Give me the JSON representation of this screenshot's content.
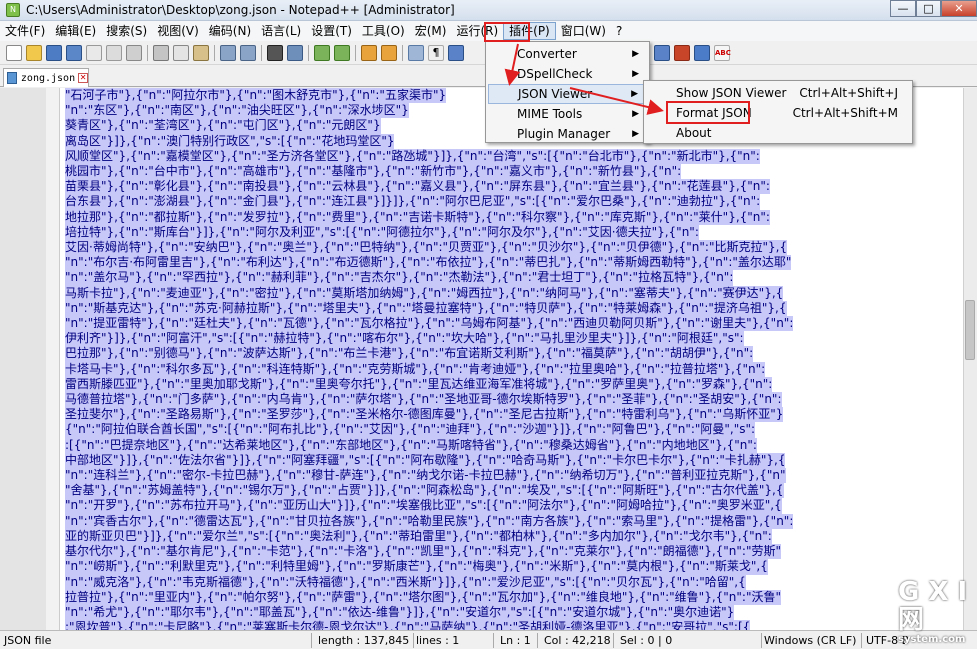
{
  "window": {
    "title": "C:\\Users\\Administrator\\Desktop\\zong.json - Notepad++ [Administrator]",
    "controls": {
      "minimize": "—",
      "maximize": "□",
      "close": "✕"
    }
  },
  "menubar": {
    "items": [
      "文件(F)",
      "编辑(E)",
      "搜索(S)",
      "视图(V)",
      "编码(N)",
      "语言(L)",
      "设置(T)",
      "工具(O)",
      "宏(M)",
      "运行(R)",
      "插件(P)",
      "窗口(W)",
      "?"
    ]
  },
  "tab": {
    "label": "zong.json",
    "close": "✕"
  },
  "plugin_menu": {
    "items": [
      {
        "label": "Converter",
        "arrow": "▶"
      },
      {
        "label": "DSpellCheck",
        "arrow": "▶"
      },
      {
        "label": "JSON Viewer",
        "arrow": "▶"
      },
      {
        "label": "MIME Tools",
        "arrow": "▶"
      },
      {
        "label": "Plugin Manager",
        "arrow": "▶"
      }
    ]
  },
  "json_viewer_submenu": {
    "items": [
      {
        "label": "Show JSON Viewer",
        "shortcut": "Ctrl+Alt+Shift+J"
      },
      {
        "label": "Format JSON",
        "shortcut": "Ctrl+Alt+Shift+M"
      },
      {
        "label": "About",
        "shortcut": ""
      }
    ]
  },
  "editor": {
    "lines": [
      "\"石河子市\"},{\"n\":\"阿拉尔市\"},{\"n\":\"图木舒克市\"},{\"n\":\"五家渠市\"}",
      "\"n\":\"东区\"},{\"n\":\"南区\"},{\"n\":\"油尖旺区\"},{\"n\":\"深水埗区\"}",
      "葵青区\"},{\"n\":\"荃湾区\"},{\"n\":\"屯门区\"},{\"n\":\"元朗区\"}",
      "离岛区\"}]},{\"n\":\"澳门特别行政区\",\"s\":[{\"n\":\"花地玛堂区\"}",
      "风顺堂区\"},{\"n\":\"嘉模堂区\"},{\"n\":\"圣方济各堂区\"},{\"n\":\"路氹城\"}]},{\"n\":\"台湾\",\"s\":[{\"n\":\"台北市\"},{\"n\":\"新北市\"},{\"n\":",
      "桃园市\"},{\"n\":\"台中市\"},{\"n\":\"高雄市\"},{\"n\":\"基隆市\"},{\"n\":\"新竹市\"},{\"n\":\"嘉义市\"},{\"n\":\"新竹县\"},{\"n\":",
      "苗栗县\"},{\"n\":\"彰化县\"},{\"n\":\"南投县\"},{\"n\":\"云林县\"},{\"n\":\"嘉义县\"},{\"n\":\"屏东县\"},{\"n\":\"宜兰县\"},{\"n\":\"花莲县\"},{\"n\":",
      "台东县\"},{\"n\":\"澎湖县\"},{\"n\":\"金门县\"},{\"n\":\"连江县\"}]}]},{\"n\":\"阿尔巴尼亚\",\"s\":[{\"n\":\"爱尔巴桑\"},{\"n\":\"迪勃拉\"},{\"n\":",
      "地拉那\"},{\"n\":\"都拉斯\"},{\"n\":\"发罗拉\"},{\"n\":\"费里\"},{\"n\":\"吉诺卡斯特\"},{\"n\":\"科尔察\"},{\"n\":\"库克斯\"},{\"n\":\"莱什\"},{\"n\":",
      "培拉特\"},{\"n\":\"斯库台\"}]},{\"n\":\"阿尔及利亚\",\"s\":[{\"n\":\"阿德拉尔\"},{\"n\":\"阿尔及尔\"},{\"n\":\"艾因·德夫拉\"},{\"n\":",
      "艾因·蒂姆尚特\"},{\"n\":\"安纳巴\"},{\"n\":\"奥兰\"},{\"n\":\"巴特纳\"},{\"n\":\"贝贾亚\"},{\"n\":\"贝沙尔\"},{\"n\":\"贝伊德\"},{\"n\":\"比斯克拉\"},{",
      "\"n\":\"布尔吉·布阿雷里吉\"},{\"n\":\"布利达\"},{\"n\":\"布迈德斯\"},{\"n\":\"布依拉\"},{\"n\":\"蒂巴扎\"},{\"n\":\"蒂斯姆西勒特\"},{\"n\":\"盖尔达耶\"",
      "\"n\":\"盖尔马\"},{\"n\":\"罕西拉\"},{\"n\":\"赫利菲\"},{\"n\":\"吉杰尔\"},{\"n\":\"杰勒法\"},{\"n\":\"君士坦丁\"},{\"n\":\"拉格瓦特\"},{\"n\":",
      "马斯卡拉\"},{\"n\":\"麦迪亚\"},{\"n\":\"密拉\"},{\"n\":\"莫斯塔加纳姆\"},{\"n\":\"姆西拉\"},{\"n\":\"纳阿马\"},{\"n\":\"塞蒂夫\"},{\"n\":\"赛伊达\"},{",
      "\"n\":\"斯基克达\"},{\"n\":\"苏克·阿赫拉斯\"},{\"n\":\"塔里夫\"},{\"n\":\"塔曼拉塞特\"},{\"n\":\"特贝萨\"},{\"n\":\"特莱姆森\"},{\"n\":\"提济乌祖\"},{",
      "\"n\":\"提亚雷特\"},{\"n\":\"廷杜夫\"},{\"n\":\"瓦德\"},{\"n\":\"瓦尔格拉\"},{\"n\":\"乌姆布阿基\"},{\"n\":\"西迪贝勒阿贝斯\"},{\"n\":\"谢里夫\"},{\"n\":",
      "伊利齐\"}]},{\"n\":\"阿富汗\",\"s\":[{\"n\":\"赫拉特\"},{\"n\":\"喀布尔\"},{\"n\":\"坎大哈\"},{\"n\":\"马扎里沙里夫\"}]},{\"n\":\"阿根廷\",\"s\":",
      "巴拉那\"},{\"n\":\"别德马\"},{\"n\":\"波萨达斯\"},{\"n\":\"布兰卡港\"},{\"n\":\"布宜诺斯艾利斯\"},{\"n\":\"福莫萨\"},{\"n\":\"胡胡伊\"},{\"n\":",
      "卡塔马卡\"},{\"n\":\"科尔多瓦\"},{\"n\":\"科连特斯\"},{\"n\":\"克劳斯城\"},{\"n\":\"肯考迪娅\"},{\"n\":\"拉里奥哈\"},{\"n\":\"拉普拉塔\"},{\"n\":",
      "雷西斯滕匹亚\"},{\"n\":\"里奥加耶戈斯\"},{\"n\":\"里奥夸尔托\"},{\"n\":\"里瓦达维亚海军准将城\"},{\"n\":\"罗萨里奥\"},{\"n\":\"罗森\"},{\"n\":",
      "马德普拉塔\"},{\"n\":\"门多萨\"},{\"n\":\"内乌肯\"},{\"n\":\"萨尔塔\"},{\"n\":\"圣地亚哥-德尔埃斯特罗\"},{\"n\":\"圣菲\"},{\"n\":\"圣胡安\"},{\"n\":",
      "圣拉斐尔\"},{\"n\":\"圣路易斯\"},{\"n\":\"圣罗莎\"},{\"n\":\"圣米格尔-德图库曼\"},{\"n\":\"圣尼古拉斯\"},{\"n\":\"特雷利乌\"},{\"n\":\"乌斯怀亚\"}",
      "{\"n\":\"阿拉伯联合酋长国\",\"s\":[{\"n\":\"阿布扎比\"},{\"n\":\"艾因\"},{\"n\":\"迪拜\"},{\"n\":\"沙迦\"}]},{\"n\":\"阿鲁巴\"},{\"n\":\"阿曼\",\"s\":",
      ":[{\"n\":\"巴提奈地区\"},{\"n\":\"达希莱地区\"},{\"n\":\"东部地区\"},{\"n\":\"马斯喀特省\"},{\"n\":\"穆桑达姆省\"},{\"n\":\"内地地区\"},{\"n\":",
      "中部地区\"}]},{\"n\":\"佐法尔省\"}]},{\"n\":\"阿塞拜疆\",\"s\":[{\"n\":\"阿布歇隆\"},{\"n\":\"哈奇马斯\"},{\"n\":\"卡尔巴卡尔\"},{\"n\":\"卡扎赫\"},{",
      "\"n\":\"连科兰\"},{\"n\":\"密尔-卡拉巴赫\"},{\"n\":\"穆甘-萨连\"},{\"n\":\"纳戈尔诺-卡拉巴赫\"},{\"n\":\"纳希切万\"},{\"n\":\"普利亚拉克斯\"},{\"n\"",
      "\"舍基\"},{\"n\":\"苏姆盖特\"},{\"n\":\"锡尔万\"},{\"n\":\"占贾\"}]},{\"n\":\"阿森松岛\"},{\"n\":\"埃及\",\"s\":[{\"n\":\"阿斯旺\"},{\"n\":\"古尔代盖\"},{",
      "\"n\":\"开罗\"},{\"n\":\"苏布拉开马\"},{\"n\":\"亚历山大\"}]},{\"n\":\"埃塞俄比亚\",\"s\":[{\"n\":\"阿法尔\"},{\"n\":\"阿姆哈拉\"},{\"n\":\"奥罗米亚\",{",
      "\"n\":\"宾香古尔\"},{\"n\":\"德雷达瓦\"},{\"n\":\"甘贝拉各族\"},{\"n\":\"哈勒里民族\"},{\"n\":\"南方各族\"},{\"n\":\"索马里\"},{\"n\":\"提格雷\"},{\"n\":",
      "亚的斯亚贝巴\"}]},{\"n\":\"爱尔兰\",\"s\":[{\"n\":\"奥法利\"},{\"n\":\"蒂珀雷里\"},{\"n\":\"都柏林\"},{\"n\":\"多内加尔\"},{\"n\":\"戈尔韦\"},{\"n\":",
      "基尔代尔\"},{\"n\":\"基尔肯尼\"},{\"n\":\"卡范\"},{\"n\":\"卡洛\"},{\"n\":\"凯里\"},{\"n\":\"科克\"},{\"n\":\"克莱尔\"},{\"n\":\"朗福德\"},{\"n\":\"劳斯\"",
      "\"n\":\"崂斯\"},{\"n\":\"利默里克\"},{\"n\":\"利特里姆\"},{\"n\":\"罗斯康芒\"},{\"n\":\"梅奥\"},{\"n\":\"米斯\"},{\"n\":\"莫内根\"},{\"n\":\"斯莱戈\",{",
      "\"n\":\"威克洛\"},{\"n\":\"韦克斯福德\"},{\"n\":\"沃特福德\"},{\"n\":\"西米斯\"}]},{\"n\":\"爱沙尼亚\",\"s\":[{\"n\":\"贝尔瓦\"},{\"n\":\"哈留\",{",
      "拉普拉\"},{\"n\":\"里亚内\"},{\"n\":\"帕尔努\"},{\"n\":\"萨雷\"},{\"n\":\"塔尔图\"},{\"n\":\"瓦尔加\"},{\"n\":\"维良地\"},{\"n\":\"维鲁\"},{\"n\":\"沃鲁\"",
      "\"n\":\"希尤\"},{\"n\":\"耶尔韦\"},{\"n\":\"耶盖瓦\"},{\"n\":\"依达-维鲁\"}]},{\"n\":\"安道尔\",\"s\":[{\"n\":\"安道尔城\"},{\"n\":\"奥尔迪诺\"}",
      ":\"恩坎普\"},{\"n\":\"卡尼略\"},{\"n\":\"莱塞斯卡尔德-恩戈尔达\"},{\"n\":\"马萨纳\"},{\"n\":\"圣胡利娅-德洛里亚\"},{\"n\":\"安哥拉\",\"s\":[{",
      "\"n\":\"北宽扎\"},{\"n\":\"北隆达\"},{\"n\":\"本戈\"},{\"n\":\"本格拉\"},{\"n\":\"比耶\"},{\"n\":\"卡宾达\"},{\"n\":\"库内内\"},{\"n\":\"宽多库"
    ]
  },
  "statusbar": {
    "file_type": "JSON file",
    "length": "length : 137,845",
    "lines": "lines : 1",
    "ln": "Ln : 1",
    "col": "Col : 42,218",
    "sel": "Sel : 0 | 0",
    "eol": "Windows (CR LF)",
    "encoding": "UTF-8-B"
  },
  "watermark": {
    "big": "G X I 网",
    "small": "system.com"
  },
  "colors": {
    "selection_bg": "#c8c8f8",
    "text": "#000080",
    "highlight_box": "#e02020"
  }
}
